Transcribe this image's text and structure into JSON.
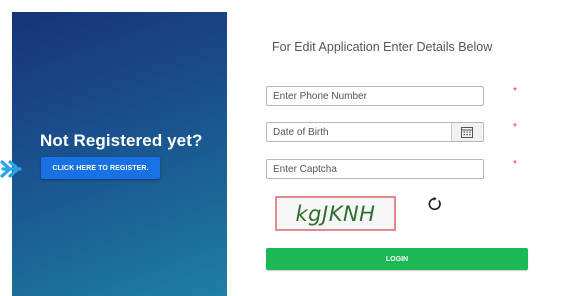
{
  "left_panel": {
    "heading": "Not Registered yet?",
    "register_button": "CLICK HERE TO REGISTER."
  },
  "form": {
    "heading": "For Edit Application Enter Details Below",
    "phone": {
      "placeholder": "Enter Phone Number",
      "value": ""
    },
    "dob": {
      "placeholder": "Date of Birth",
      "value": ""
    },
    "captcha_input": {
      "placeholder": "Enter Captcha",
      "value": ""
    },
    "required_marker": "*",
    "captcha_image_text": "kgJKNH",
    "login_button": "LOGIN"
  },
  "icons": {
    "pointer": "arrow-right-icon",
    "calendar": "calendar-icon",
    "refresh": "refresh-icon"
  },
  "colors": {
    "panel_gradient_start": "#16337a",
    "panel_gradient_end": "#1f7fa6",
    "register_button": "#1971e6",
    "login_button": "#1db954",
    "required": "#e33333",
    "captcha_border": "#e58a8a",
    "captcha_text": "#2f6e2f"
  }
}
